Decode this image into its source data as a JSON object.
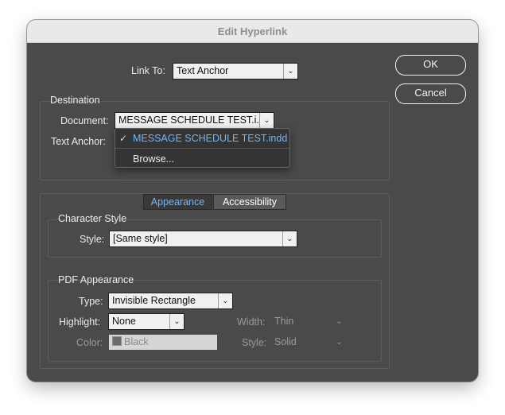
{
  "dialog": {
    "title": "Edit Hyperlink",
    "ok_label": "OK",
    "cancel_label": "Cancel"
  },
  "link_to": {
    "label": "Link To:",
    "value": "Text Anchor"
  },
  "destination": {
    "title": "Destination",
    "document_label": "Document:",
    "document_value": "MESSAGE SCHEDULE TEST.i...",
    "text_anchor_label": "Text Anchor:",
    "popup": {
      "items": [
        {
          "label": "MESSAGE SCHEDULE TEST.indd",
          "checked": true
        },
        {
          "label": "Browse...",
          "checked": false
        }
      ]
    }
  },
  "tabs": [
    {
      "label": "Appearance",
      "active": true
    },
    {
      "label": "Accessibility",
      "active": false
    }
  ],
  "character_style": {
    "title": "Character Style",
    "style_label": "Style:",
    "style_value": "[Same style]"
  },
  "pdf_appearance": {
    "title": "PDF Appearance",
    "type_label": "Type:",
    "type_value": "Invisible Rectangle",
    "highlight_label": "Highlight:",
    "highlight_value": "None",
    "width_label": "Width:",
    "width_value": "Thin",
    "color_label": "Color:",
    "color_value": "Black",
    "style_label": "Style:",
    "style_value": "Solid"
  },
  "icons": {
    "chevron": "chevron-down-icon",
    "check": "checkmark-icon",
    "swatch": "color-swatch-icon"
  },
  "colors": {
    "dialog_bg": "#4a4a4a",
    "accent": "#6fb6ff",
    "titlebar_bg": "#e9e9e9"
  }
}
